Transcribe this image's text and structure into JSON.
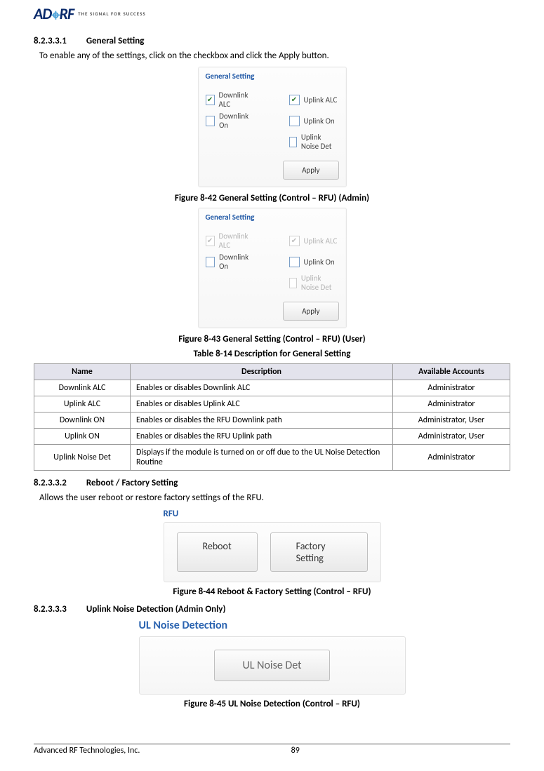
{
  "logo": {
    "brand_a": "A",
    "brand_d": "D",
    "brand_r": "R",
    "brand_f": "F",
    "tagline": "THE SIGNAL FOR SUCCESS"
  },
  "sec1": {
    "num": "8.2.3.3.1",
    "title": "General Setting",
    "intro": "To enable any of the settings, click on the checkbox and click the Apply button."
  },
  "shot1": {
    "title": "General Setting",
    "dl_alc": "Downlink ALC",
    "ul_alc": "Uplink ALC",
    "dl_on": "Downlink On",
    "ul_on": "Uplink On",
    "ul_noise": "Uplink Noise Det",
    "apply": "Apply"
  },
  "cap1": "Figure 8-42    General Setting (Control – RFU) (Admin)",
  "shot2": {
    "title": "General Setting",
    "dl_alc": "Downlink ALC",
    "ul_alc": "Uplink ALC",
    "dl_on": "Downlink On",
    "ul_on": "Uplink On",
    "ul_noise": "Uplink Noise Det",
    "apply": "Apply"
  },
  "cap2": "Figure 8-43    General Setting (Control – RFU) (User)",
  "tcap": "Table 8-14     Description for General Setting",
  "table": {
    "h_name": "Name",
    "h_desc": "Description",
    "h_acct": "Available Accounts",
    "rows": [
      {
        "name": "Downlink ALC",
        "desc": "Enables or disables Downlink ALC",
        "acct": "Administrator"
      },
      {
        "name": "Uplink ALC",
        "desc": "Enables or disables Uplink ALC",
        "acct": "Administrator"
      },
      {
        "name": "Downlink ON",
        "desc": "Enables or disables the RFU Downlink path",
        "acct": "Administrator, User"
      },
      {
        "name": "Uplink ON",
        "desc": "Enables or disables the RFU Uplink path",
        "acct": "Administrator, User"
      },
      {
        "name": "Uplink Noise Det",
        "desc": "Displays if the module is turned on or off due to the UL Noise Detection Routine",
        "acct": "Administrator"
      }
    ]
  },
  "sec2": {
    "num": "8.2.3.3.2",
    "title": "Reboot / Factory Setting",
    "intro": "Allows the user reboot or restore factory settings of the RFU."
  },
  "rfu": {
    "title": "RFU",
    "reboot": "Reboot",
    "factory": "Factory Setting"
  },
  "cap3": "Figure 8-44    Reboot & Factory Setting (Control – RFU)",
  "sec3": {
    "num": "8.2.3.3.3",
    "title": "Uplink Noise Detection (Admin Only)"
  },
  "uln": {
    "title": "UL Noise Detection",
    "btn": "UL Noise Det"
  },
  "cap4": "Figure 8-45    UL Noise Detection (Control – RFU)",
  "footer": {
    "company": "Advanced RF Technologies, Inc.",
    "page": "89"
  }
}
